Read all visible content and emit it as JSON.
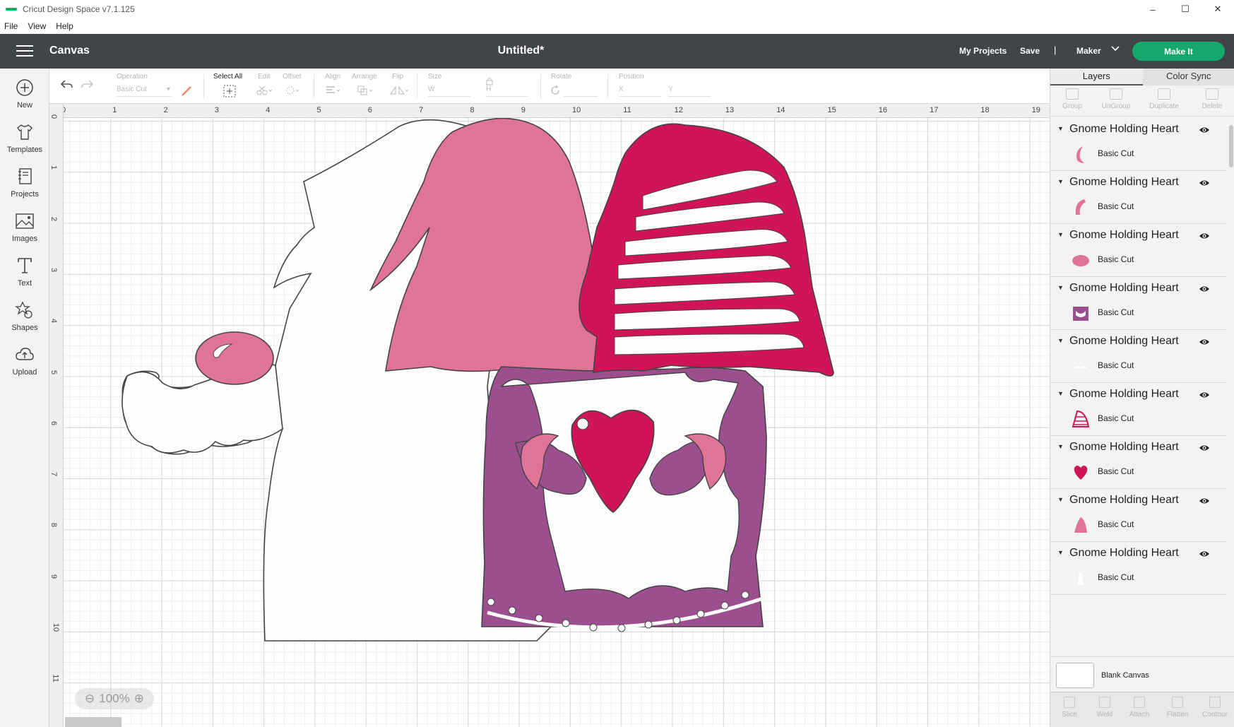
{
  "window": {
    "title": "Cricut Design Space  v7.1.125",
    "controls": [
      "–",
      "☐",
      "✕"
    ]
  },
  "menu": [
    "File",
    "View",
    "Help"
  ],
  "header": {
    "section": "Canvas",
    "document": "Untitled*",
    "my_projects": "My Projects",
    "save": "Save",
    "separator": "|",
    "machine": "Maker",
    "make_it": "Make It",
    "make_it_color": "#14a86a"
  },
  "left_tools": [
    {
      "label": "New",
      "icon": "plus-circle-icon"
    },
    {
      "label": "Templates",
      "icon": "tshirt-icon"
    },
    {
      "label": "Projects",
      "icon": "projects-icon"
    },
    {
      "label": "Images",
      "icon": "image-icon"
    },
    {
      "label": "Text",
      "icon": "text-icon"
    },
    {
      "label": "Shapes",
      "icon": "shapes-icon"
    },
    {
      "label": "Upload",
      "icon": "cloud-upload-icon"
    }
  ],
  "toolbar": {
    "operation_label": "Operation",
    "operation_value": "Basic Cut",
    "select_all": "Select All",
    "edit": "Edit",
    "offset": "Offset",
    "align": "Align",
    "arrange": "Arrange",
    "flip": "Flip",
    "size": "Size",
    "size_w": "W",
    "size_h": "H",
    "rotate": "Rotate",
    "position": "Position",
    "pos_x": "X",
    "pos_y": "Y"
  },
  "rulers": {
    "top": [
      "0",
      "1",
      "2",
      "3",
      "4",
      "5",
      "6",
      "7",
      "8",
      "9",
      "10",
      "11",
      "12",
      "13",
      "14",
      "15",
      "16",
      "17",
      "18",
      "19"
    ],
    "left": [
      "0",
      "1",
      "2",
      "3",
      "4",
      "5",
      "6",
      "7",
      "8",
      "9",
      "10",
      "11"
    ]
  },
  "zoom": "100%",
  "panel": {
    "tabs": [
      "Layers",
      "Color Sync"
    ],
    "actions": [
      "Group",
      "UnGroup",
      "Duplicate",
      "Delete"
    ],
    "layers": [
      {
        "name": "Gnome Holding Heart",
        "sub": "Basic Cut",
        "thumb": "crescent",
        "color": "#df7497"
      },
      {
        "name": "Gnome Holding Heart",
        "sub": "Basic Cut",
        "thumb": "horn",
        "color": "#df7497"
      },
      {
        "name": "Gnome Holding Heart",
        "sub": "Basic Cut",
        "thumb": "nose",
        "color": "#df7497"
      },
      {
        "name": "Gnome Holding Heart",
        "sub": "Basic Cut",
        "thumb": "purple",
        "color": "#9b4f8f"
      },
      {
        "name": "Gnome Holding Heart",
        "sub": "Basic Cut",
        "thumb": "white",
        "color": "#ffffff"
      },
      {
        "name": "Gnome Holding Heart",
        "sub": "Basic Cut",
        "thumb": "hatlines",
        "color": "#cf1457"
      },
      {
        "name": "Gnome Holding Heart",
        "sub": "Basic Cut",
        "thumb": "heart",
        "color": "#cf1457"
      },
      {
        "name": "Gnome Holding Heart",
        "sub": "Basic Cut",
        "thumb": "hat",
        "color": "#df7497"
      },
      {
        "name": "Gnome Holding Heart",
        "sub": "Basic Cut",
        "thumb": "beard",
        "color": "#ffffff"
      }
    ],
    "blank_canvas": "Blank Canvas",
    "bottom_actions": [
      "Slice",
      "Weld",
      "Attach",
      "Flatten",
      "Contour"
    ]
  }
}
